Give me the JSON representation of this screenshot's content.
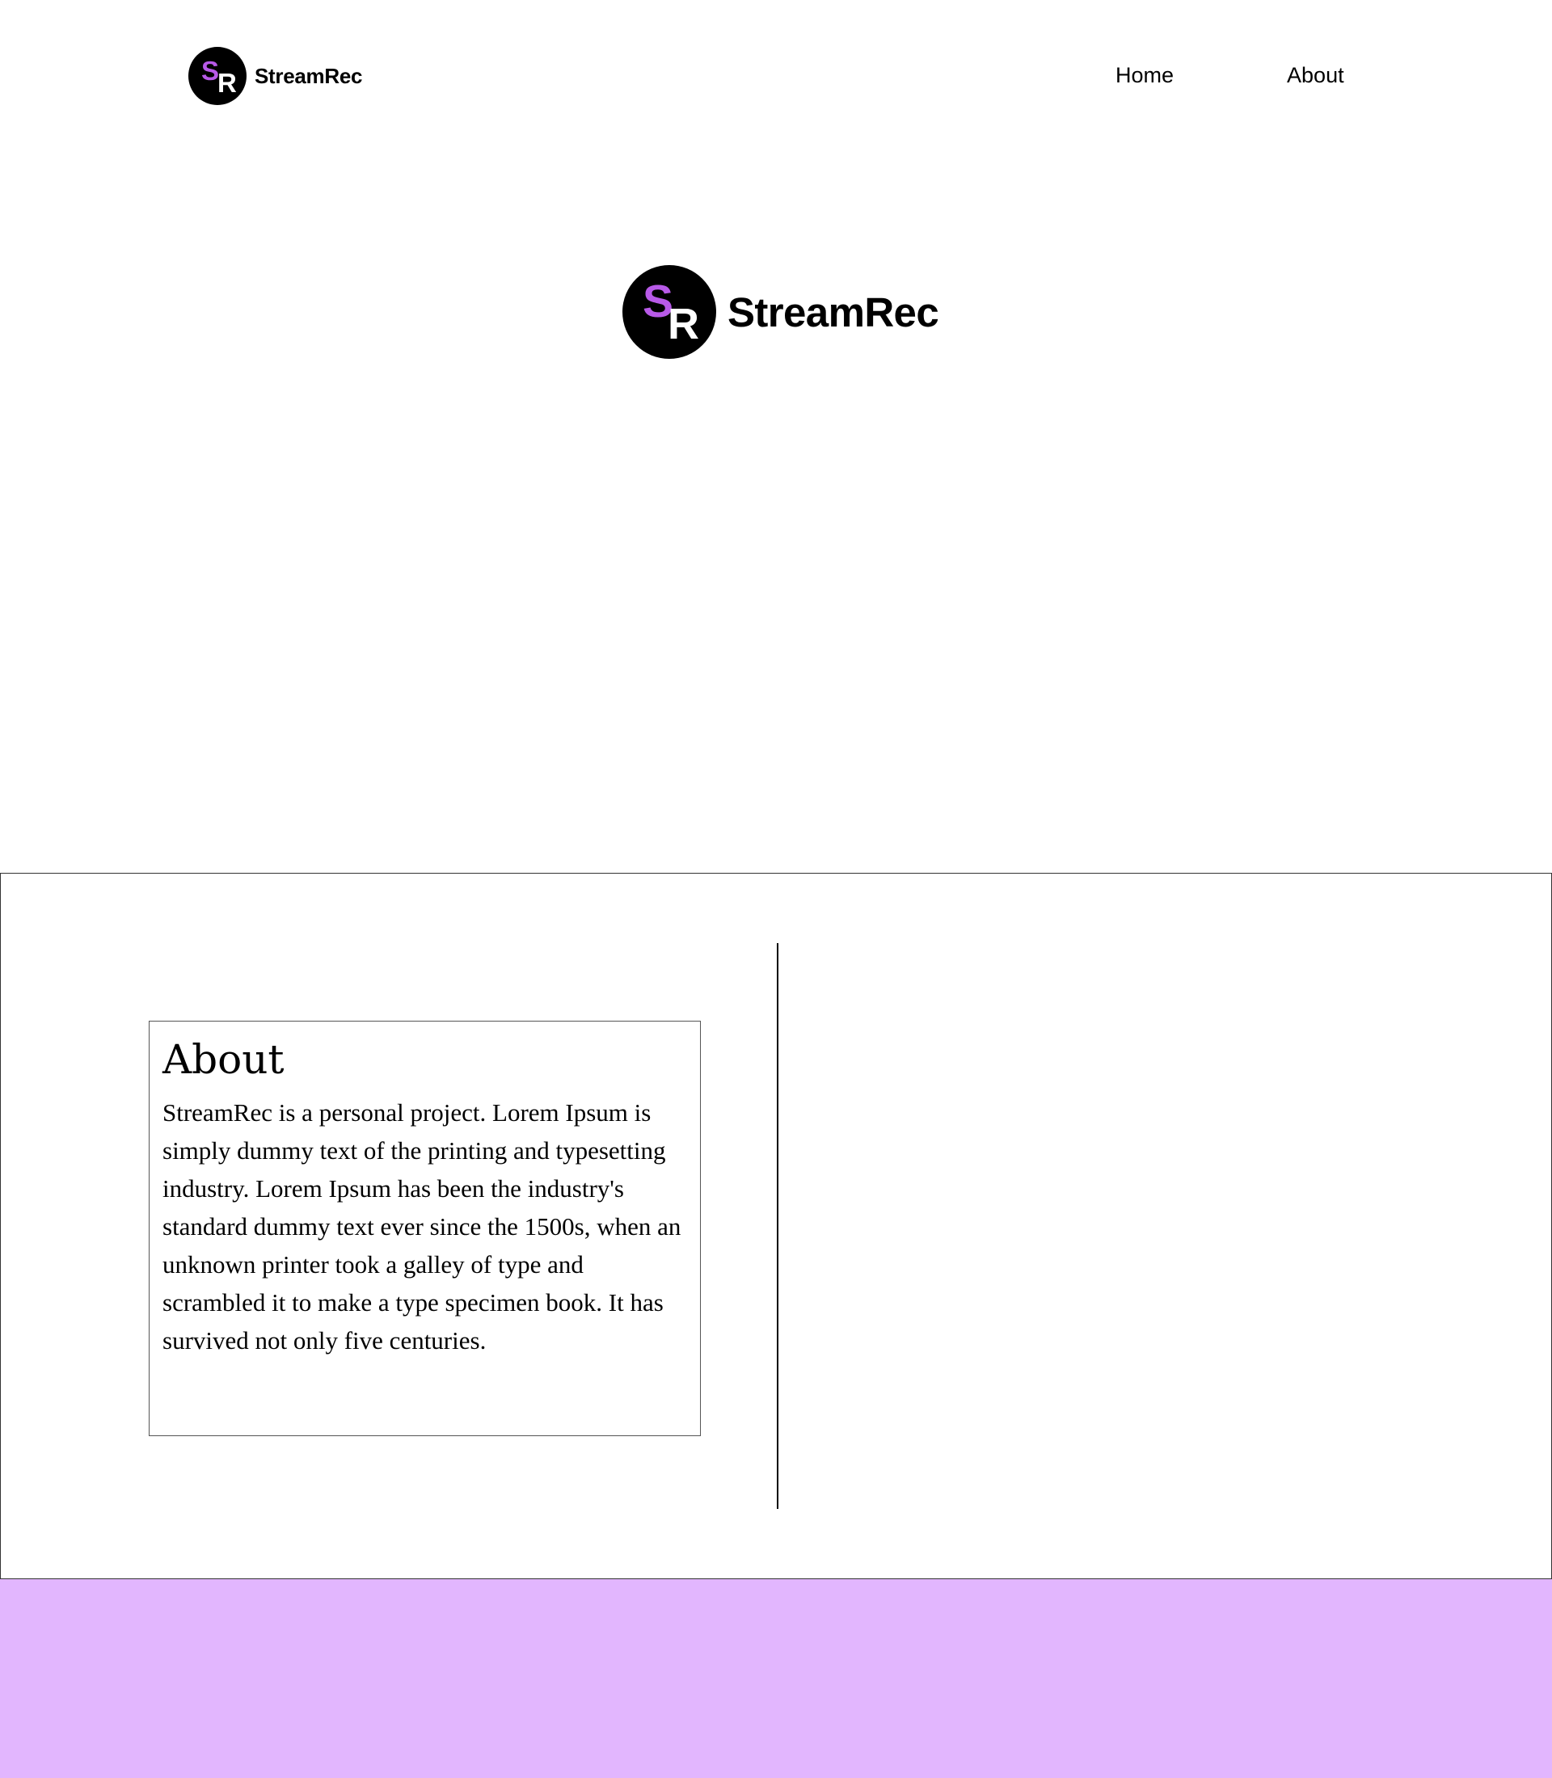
{
  "brand": {
    "name": "StreamRec",
    "logo_letters": {
      "first": "S",
      "second": "R"
    }
  },
  "nav": {
    "items": [
      {
        "label": "Home"
      },
      {
        "label": "About"
      }
    ]
  },
  "hero": {
    "title": "StreamRec"
  },
  "about": {
    "title": "About",
    "body": "StreamRec is a personal project. Lorem Ipsum is simply dummy text of the printing and typesetting industry. Lorem Ipsum has been the industry's standard dummy text ever since the 1500s, when an unknown printer took a galley of type and scrambled it to make a type specimen book. It has survived not only five centuries."
  },
  "colors": {
    "logo_s": "#b85ae8",
    "footer_bg": "#e2b6fe"
  }
}
